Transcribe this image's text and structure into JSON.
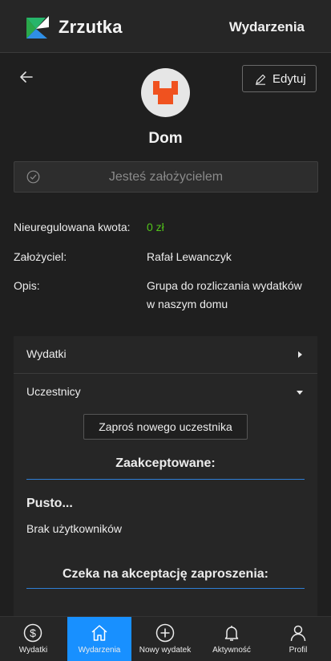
{
  "header": {
    "brand": "Zrzutka",
    "nav_link": "Wydarzenia"
  },
  "group": {
    "title": "Dom",
    "edit_label": "Edytuj",
    "founder_banner": "Jesteś założycielem",
    "fields": [
      {
        "label": "Nieuregulowana kwota:",
        "value": "0 zł"
      },
      {
        "label": "Założyciel:",
        "value": "Rafał Lewanczyk"
      },
      {
        "label": "Opis:",
        "value_line1": "Grupa do rozliczania wydatków",
        "value_line2": "w naszym domu"
      }
    ]
  },
  "panel": {
    "expenses_label": "Wydatki",
    "participants_label": "Uczestnicy",
    "invite_button": "Zaproś nowego uczestnika",
    "accepted_heading": "Zaakceptowane:",
    "empty_title": "Pusto...",
    "empty_sub": "Brak użytkowników",
    "pending_heading": "Czeka na akceptację zaproszenia:"
  },
  "bottom_nav": [
    {
      "label": "Wydatki",
      "icon": "dollar-icon",
      "active": false
    },
    {
      "label": "Wydarzenia",
      "icon": "home-icon",
      "active": true
    },
    {
      "label": "Nowy wydatek",
      "icon": "plus-circle-icon",
      "active": false
    },
    {
      "label": "Aktywność",
      "icon": "bell-icon",
      "active": false
    },
    {
      "label": "Profil",
      "icon": "user-icon",
      "active": false
    }
  ],
  "colors": {
    "background": "#1f1f1f",
    "surface": "#262626",
    "accent": "#1890ff",
    "success": "#52c41a",
    "avatar_icon": "#f0521f"
  }
}
